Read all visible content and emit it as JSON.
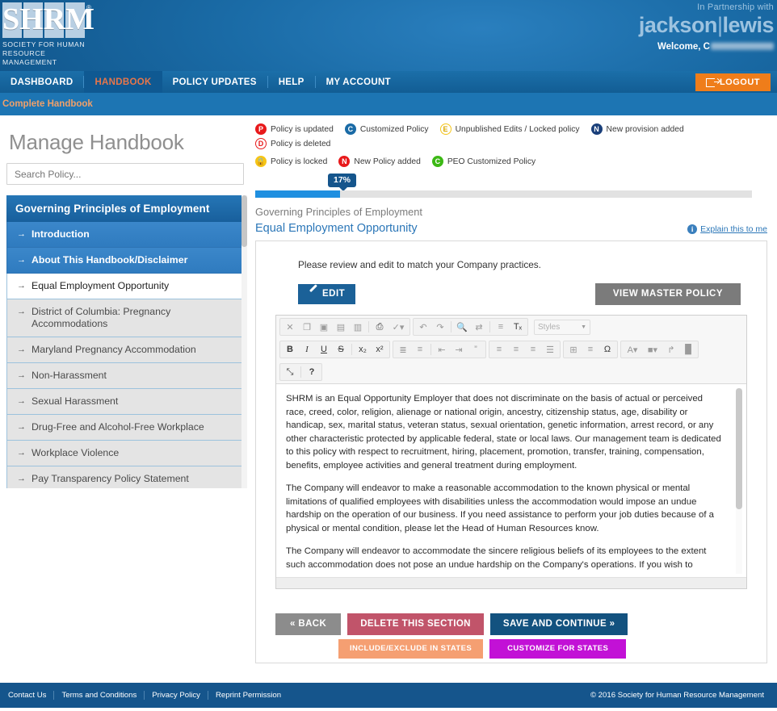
{
  "header": {
    "logo_text": "SHRM",
    "logo_registered": "®",
    "logo_tagline_line1": "SOCIETY FOR HUMAN",
    "logo_tagline_line2": "RESOURCE MANAGEMENT",
    "partnership_label": "In Partnership with",
    "partner_first": "jackson",
    "partner_separator": "|",
    "partner_second": "lewis",
    "welcome_label": "Welcome, C",
    "logout_label": "LOGOUT"
  },
  "nav": {
    "items": [
      {
        "label": "DASHBOARD",
        "active": false
      },
      {
        "label": "HANDBOOK",
        "active": true
      },
      {
        "label": "POLICY UPDATES",
        "active": false
      },
      {
        "label": "HELP",
        "active": false
      },
      {
        "label": "MY ACCOUNT",
        "active": false
      }
    ]
  },
  "subnav": {
    "label": "Complete Handbook"
  },
  "sidebar": {
    "page_title": "Manage Handbook",
    "search_placeholder": "Search Policy...",
    "menu_header": "Governing Principles of Employment",
    "items": [
      {
        "label": "Introduction",
        "state": "sel-blue"
      },
      {
        "label": "About This Handbook/Disclaimer",
        "state": "sel-blue"
      },
      {
        "label": "Equal Employment Opportunity",
        "state": "current"
      },
      {
        "label": "District of Columbia: Pregnancy Accommodations",
        "state": "normal"
      },
      {
        "label": "Maryland Pregnancy Accommodation",
        "state": "normal"
      },
      {
        "label": "Non-Harassment",
        "state": "normal"
      },
      {
        "label": "Sexual Harassment",
        "state": "normal"
      },
      {
        "label": "Drug-Free and Alcohol-Free Workplace",
        "state": "normal"
      },
      {
        "label": "Workplace Violence",
        "state": "normal"
      },
      {
        "label": "Pay Transparency Policy Statement",
        "state": "normal"
      },
      {
        "label": "",
        "state": "orange"
      }
    ]
  },
  "legend": {
    "items": [
      {
        "letter": "P",
        "label": "Policy is updated",
        "color": "#e8191b",
        "text_color": "#ffffff",
        "outline": false
      },
      {
        "letter": "C",
        "label": "Customized Policy",
        "color": "#1a6ba6",
        "text_color": "#ffffff",
        "outline": false
      },
      {
        "letter": "E",
        "label": "Unpublished Edits / Locked policy",
        "color": "#f5c518",
        "text_color": "#c8a000",
        "outline": true
      },
      {
        "letter": "N",
        "label": "New provision added",
        "color": "#1a3f7a",
        "text_color": "#ffffff",
        "outline": false
      },
      {
        "letter": "D",
        "label": "Policy is deleted",
        "color": "#e8191b",
        "text_color": "#e8191b",
        "outline": true
      },
      {
        "letter": "Δ",
        "label": "Policy is locked",
        "color": "#f5c518",
        "text_color": "#b07a00",
        "outline": false
      },
      {
        "letter": "N",
        "label": "New Policy added",
        "color": "#e8191b",
        "text_color": "#ffffff",
        "outline": false
      },
      {
        "letter": "C",
        "label": "PEO Customized Policy",
        "color": "#3cb815",
        "text_color": "#ffffff",
        "outline": false
      }
    ]
  },
  "progress": {
    "percent_label": "17%",
    "percent": 17
  },
  "main": {
    "breadcrumb": "Governing Principles of Employment",
    "section_title": "Equal Employment Opportunity",
    "explain_link": "Explain this to me",
    "instruction": "Please review and edit to match your Company practices.",
    "edit_button": "EDIT",
    "view_master_button": "VIEW MASTER POLICY",
    "styles_placeholder": "Styles",
    "paragraphs": [
      "SHRM is an Equal Opportunity Employer that does not discriminate on the basis of actual or perceived race, creed, color, religion, alienage or national origin, ancestry, citizenship status, age, disability or handicap, sex, marital status, veteran status, sexual orientation, genetic information, arrest record, or any other characteristic protected by applicable federal, state or local laws. Our management team is dedicated to this policy with respect to recruitment, hiring, placement, promotion, transfer, training, compensation, benefits, employee activities and general treatment during employment.",
      "The Company will endeavor to make a reasonable accommodation to the known physical or mental limitations of qualified employees with disabilities unless the accommodation would impose an undue hardship on the operation of our business. If you need assistance to perform your job duties because of a physical or mental condition, please let the Head of Human Resources know.",
      "The Company will endeavor to accommodate the sincere religious beliefs of its employees to the extent such accommodation does not pose an undue hardship on the Company's operations. If you wish to"
    ],
    "toolbar": {
      "row1_group1": [
        {
          "icon": "✕",
          "name": "cut-icon"
        },
        {
          "icon": "❐",
          "name": "copy-icon"
        },
        {
          "icon": "▣",
          "name": "paste-icon"
        },
        {
          "icon": "▤",
          "name": "paste-text-icon"
        },
        {
          "icon": "▥",
          "name": "paste-word-icon"
        },
        {
          "icon": "⎙",
          "name": "print-icon",
          "dark": true
        },
        {
          "icon": "✓▾",
          "name": "spellcheck-icon"
        }
      ],
      "row1_group2": [
        {
          "icon": "↶",
          "name": "undo-icon"
        },
        {
          "icon": "↷",
          "name": "redo-icon"
        },
        {
          "icon": "⚲",
          "name": "find-icon",
          "dark": true
        },
        {
          "icon": "⮌",
          "name": "replace-icon"
        },
        {
          "icon": "≡",
          "name": "select-all-icon"
        },
        {
          "icon": "Tx",
          "name": "remove-format-icon",
          "dark": true
        }
      ],
      "row2_group1": [
        {
          "icon": "B",
          "name": "bold-icon",
          "dark": true
        },
        {
          "icon": "I",
          "name": "italic-icon",
          "dark": true
        },
        {
          "icon": "U",
          "name": "underline-icon",
          "dark": true
        },
        {
          "icon": "S",
          "name": "strikethrough-icon",
          "dark": true
        },
        {
          "icon": "x₂",
          "name": "subscript-icon",
          "dark": true
        },
        {
          "icon": "x²",
          "name": "superscript-icon",
          "dark": true
        }
      ],
      "row2_group2": [
        {
          "icon": "☷",
          "name": "numbered-list-icon"
        },
        {
          "icon": "☰",
          "name": "bulleted-list-icon"
        },
        {
          "icon": "⇤",
          "name": "decrease-indent-icon"
        },
        {
          "icon": "⇥",
          "name": "increase-indent-icon"
        },
        {
          "icon": "”",
          "name": "blockquote-icon"
        }
      ],
      "row2_group3": [
        {
          "icon": "≡",
          "name": "align-left-icon"
        },
        {
          "icon": "≡",
          "name": "align-center-icon"
        },
        {
          "icon": "≡",
          "name": "align-right-icon"
        },
        {
          "icon": "≡",
          "name": "justify-icon"
        }
      ],
      "row2_group4": [
        {
          "icon": "⊞",
          "name": "table-icon"
        },
        {
          "icon": "—",
          "name": "horizontal-rule-icon"
        },
        {
          "icon": "Ω",
          "name": "special-character-icon",
          "dark": true
        }
      ],
      "row2_group5": [
        {
          "icon": "A▾",
          "name": "text-color-icon"
        },
        {
          "icon": "A▾",
          "name": "background-color-icon"
        },
        {
          "icon": "↳",
          "name": "page-break-icon"
        },
        {
          "icon": "⛰",
          "name": "image-icon"
        }
      ],
      "row3": [
        {
          "icon": "⤡",
          "name": "maximize-icon",
          "dark": true
        },
        {
          "icon": "?",
          "name": "help-icon",
          "dark": true
        }
      ]
    },
    "actions": {
      "back": "« BACK",
      "delete": "DELETE THIS SECTION",
      "save": "SAVE AND CONTINUE »",
      "include_exclude": "INCLUDE/EXCLUDE IN STATES",
      "customize": "CUSTOMIZE FOR STATES"
    }
  },
  "footer": {
    "links": [
      "Contact Us",
      "Terms and Conditions",
      "Privacy Policy",
      "Reprint Permission"
    ],
    "copyright": "© 2016 Society for Human Resource Management"
  }
}
